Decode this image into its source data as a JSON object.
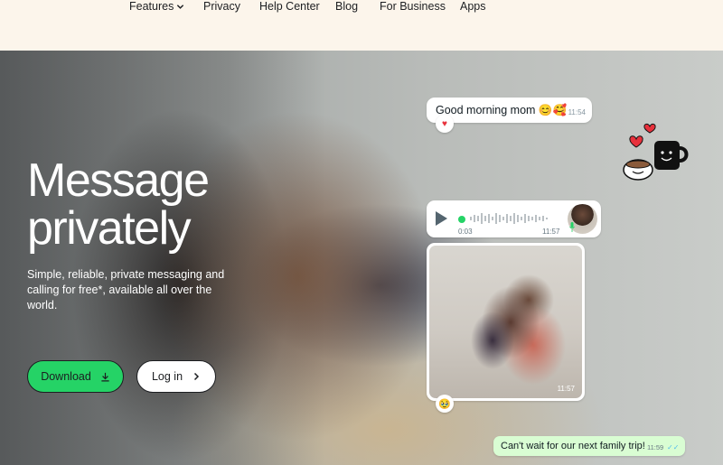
{
  "nav": {
    "items": [
      {
        "label": "Features",
        "has_dropdown": true
      },
      {
        "label": "Privacy"
      },
      {
        "label": "Help Center"
      },
      {
        "label": "Blog"
      },
      {
        "label": "For Business"
      },
      {
        "label": "Apps"
      }
    ]
  },
  "hero": {
    "headline_line1": "Message",
    "headline_line2": "privately",
    "subtext": "Simple, reliable, private messaging and calling for free*, available all over the world.",
    "download_label": "Download",
    "download_icon": "download-icon",
    "login_label": "Log in",
    "login_icon": "chevron-right-icon"
  },
  "chat": {
    "morning": {
      "text": "Good morning mom 😊🥰",
      "time": "11:54",
      "reaction": "♥"
    },
    "voice": {
      "duration": "0:03",
      "time": "11:57"
    },
    "photo": {
      "time": "11:57",
      "reaction": "🥹"
    },
    "trip": {
      "text": "Can't wait for our next family trip!",
      "time": "11:59",
      "ticks": "✓✓"
    }
  },
  "colors": {
    "brand_green": "#25d366",
    "background": "#fcf5eb",
    "sent_bubble": "#d9fdd3",
    "read_ticks": "#53bdeb"
  }
}
